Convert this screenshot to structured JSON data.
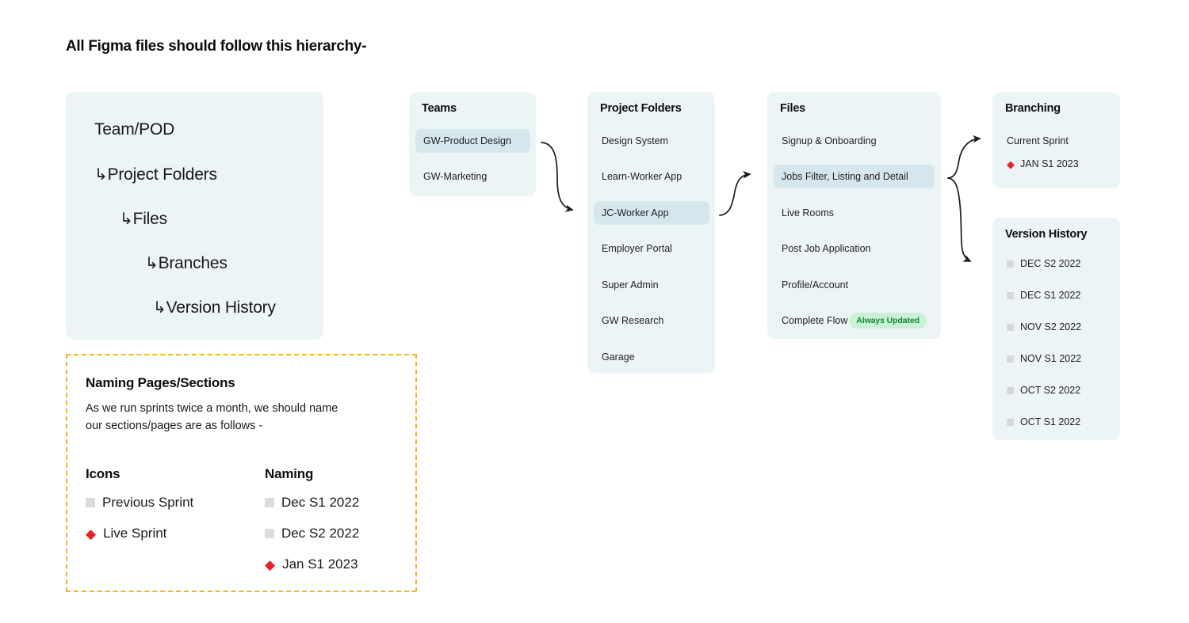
{
  "page": {
    "title": "All Figma files should follow this hierarchy-"
  },
  "hierarchy": {
    "items": [
      {
        "arrow": "",
        "label": "Team/POD"
      },
      {
        "arrow": "↳",
        "label": "Project Folders"
      },
      {
        "arrow": "↳",
        "label": "Files"
      },
      {
        "arrow": "↳",
        "label": "Branches"
      },
      {
        "arrow": "↳",
        "label": "Version History"
      }
    ]
  },
  "naming": {
    "title": "Naming Pages/Sections",
    "description": "As we run sprints twice a month, we should name our sections/pages are as follows -",
    "icons_heading": "Icons",
    "naming_heading": "Naming",
    "icon_legend": [
      {
        "icon": "gray-square",
        "label": "Previous Sprint"
      },
      {
        "icon": "red-diamond",
        "label": "Live Sprint"
      }
    ],
    "naming_examples": [
      {
        "icon": "gray-square",
        "label": "Dec S1 2022"
      },
      {
        "icon": "gray-square",
        "label": "Dec S2 2022"
      },
      {
        "icon": "red-diamond",
        "label": "Jan S1 2023"
      }
    ]
  },
  "teams": {
    "title": "Teams",
    "items": [
      {
        "label": "GW-Product Design",
        "selected": true
      },
      {
        "label": "GW-Marketing",
        "selected": false
      }
    ]
  },
  "project_folders": {
    "title": "Project Folders",
    "items": [
      {
        "label": "Design System",
        "selected": false
      },
      {
        "label": "Learn-Worker App",
        "selected": false
      },
      {
        "label": "JC-Worker App",
        "selected": true
      },
      {
        "label": "Employer Portal",
        "selected": false
      },
      {
        "label": "Super Admin",
        "selected": false
      },
      {
        "label": "GW Research",
        "selected": false
      },
      {
        "label": "Garage",
        "selected": false
      }
    ]
  },
  "files": {
    "title": "Files",
    "items": [
      {
        "label": "Signup & Onboarding",
        "selected": false,
        "badge": ""
      },
      {
        "label": "Jobs Filter, Listing and Detail",
        "selected": true,
        "badge": ""
      },
      {
        "label": "Live Rooms",
        "selected": false,
        "badge": ""
      },
      {
        "label": "Post Job Application",
        "selected": false,
        "badge": ""
      },
      {
        "label": "Profile/Account",
        "selected": false,
        "badge": ""
      },
      {
        "label": "Complete Flow",
        "selected": false,
        "badge": "Always Updated"
      }
    ]
  },
  "branching": {
    "title": "Branching",
    "items": [
      {
        "icon": "",
        "label": "Current Sprint"
      },
      {
        "icon": "red-diamond",
        "label": "JAN S1 2023"
      }
    ]
  },
  "version_history": {
    "title": "Version History",
    "items": [
      {
        "icon": "gray-square",
        "label": "DEC S2 2022"
      },
      {
        "icon": "gray-square",
        "label": "DEC S1 2022"
      },
      {
        "icon": "gray-square",
        "label": "NOV S2 2022"
      },
      {
        "icon": "gray-square",
        "label": "NOV S1 2022"
      },
      {
        "icon": "gray-square",
        "label": "OCT S2 2022"
      },
      {
        "icon": "gray-square",
        "label": "OCT S1 2022"
      }
    ]
  },
  "colors": {
    "card_bg": "#EDF4F6",
    "selected_row": "#D5E7EC",
    "badge_bg": "#C9F2D4",
    "badge_text": "#19803C",
    "dashed_border": "#FFB016",
    "diamond_red": "#E8202A",
    "square_gray": "#DCDCDC"
  }
}
